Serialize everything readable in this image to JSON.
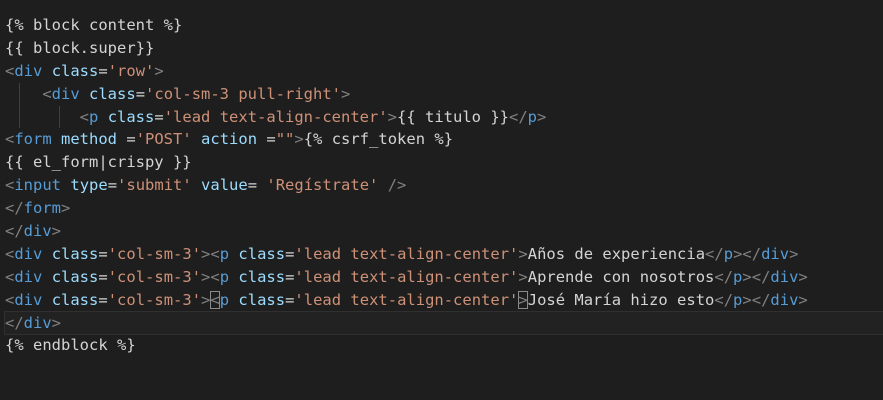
{
  "editor": {
    "current_line": 13,
    "lines": [
      {
        "indent": 0,
        "tokens": [
          {
            "t": "{% block content %}",
            "c": "text"
          }
        ]
      },
      {
        "indent": 0,
        "tokens": [
          {
            "t": "{{ block.super}}",
            "c": "text"
          }
        ]
      },
      {
        "indent": 0,
        "tokens": [
          {
            "t": "<",
            "c": "punct"
          },
          {
            "t": "div",
            "c": "tag"
          },
          {
            "t": " ",
            "c": "text"
          },
          {
            "t": "class",
            "c": "attr"
          },
          {
            "t": "=",
            "c": "text"
          },
          {
            "t": "'row'",
            "c": "str"
          },
          {
            "t": ">",
            "c": "punct"
          }
        ]
      },
      {
        "indent": 1,
        "tokens": [
          {
            "t": "<",
            "c": "punct"
          },
          {
            "t": "div",
            "c": "tag"
          },
          {
            "t": " ",
            "c": "text"
          },
          {
            "t": "class",
            "c": "attr"
          },
          {
            "t": "=",
            "c": "text"
          },
          {
            "t": "'col-sm-3 pull-right'",
            "c": "str"
          },
          {
            "t": ">",
            "c": "punct"
          }
        ]
      },
      {
        "indent": 2,
        "tokens": [
          {
            "t": "<",
            "c": "punct"
          },
          {
            "t": "p",
            "c": "tag"
          },
          {
            "t": " ",
            "c": "text"
          },
          {
            "t": "class",
            "c": "attr"
          },
          {
            "t": "=",
            "c": "text"
          },
          {
            "t": "'lead text-align-center'",
            "c": "str"
          },
          {
            "t": ">",
            "c": "punct"
          },
          {
            "t": "{{ titulo }}",
            "c": "text"
          },
          {
            "t": "</",
            "c": "punct"
          },
          {
            "t": "p",
            "c": "tag"
          },
          {
            "t": ">",
            "c": "punct"
          }
        ]
      },
      {
        "indent": 0,
        "tokens": [
          {
            "t": "<",
            "c": "punct"
          },
          {
            "t": "form",
            "c": "tag"
          },
          {
            "t": " ",
            "c": "text"
          },
          {
            "t": "method",
            "c": "attr"
          },
          {
            "t": " =",
            "c": "text"
          },
          {
            "t": "'POST'",
            "c": "str"
          },
          {
            "t": " ",
            "c": "text"
          },
          {
            "t": "action",
            "c": "attr"
          },
          {
            "t": " =",
            "c": "text"
          },
          {
            "t": "\"\"",
            "c": "str"
          },
          {
            "t": ">",
            "c": "punct"
          },
          {
            "t": "{% csrf_token %}",
            "c": "text"
          }
        ]
      },
      {
        "indent": 0,
        "tokens": [
          {
            "t": "{{ el_form|crispy }}",
            "c": "text"
          }
        ]
      },
      {
        "indent": 0,
        "tokens": [
          {
            "t": "<",
            "c": "punct"
          },
          {
            "t": "input",
            "c": "tag"
          },
          {
            "t": " ",
            "c": "text"
          },
          {
            "t": "type",
            "c": "attr"
          },
          {
            "t": "=",
            "c": "text"
          },
          {
            "t": "'submit'",
            "c": "str"
          },
          {
            "t": " ",
            "c": "text"
          },
          {
            "t": "value",
            "c": "attr"
          },
          {
            "t": "= ",
            "c": "text"
          },
          {
            "t": "'Regístrate'",
            "c": "str"
          },
          {
            "t": " />",
            "c": "punct"
          }
        ]
      },
      {
        "indent": 0,
        "tokens": [
          {
            "t": "</",
            "c": "punct"
          },
          {
            "t": "form",
            "c": "tag"
          },
          {
            "t": ">",
            "c": "punct"
          }
        ]
      },
      {
        "indent": 0,
        "tokens": [
          {
            "t": "</",
            "c": "punct"
          },
          {
            "t": "div",
            "c": "tag"
          },
          {
            "t": ">",
            "c": "punct"
          }
        ]
      },
      {
        "indent": 0,
        "tokens": [
          {
            "t": "<",
            "c": "punct"
          },
          {
            "t": "div",
            "c": "tag"
          },
          {
            "t": " ",
            "c": "text"
          },
          {
            "t": "class",
            "c": "attr"
          },
          {
            "t": "=",
            "c": "text"
          },
          {
            "t": "'col-sm-3'",
            "c": "str"
          },
          {
            "t": ">",
            "c": "punct"
          },
          {
            "t": "<",
            "c": "punct"
          },
          {
            "t": "p",
            "c": "tag"
          },
          {
            "t": " ",
            "c": "text"
          },
          {
            "t": "class",
            "c": "attr"
          },
          {
            "t": "=",
            "c": "text"
          },
          {
            "t": "'lead text-align-center'",
            "c": "str"
          },
          {
            "t": ">",
            "c": "punct"
          },
          {
            "t": "Años de experiencia",
            "c": "text"
          },
          {
            "t": "</",
            "c": "punct"
          },
          {
            "t": "p",
            "c": "tag"
          },
          {
            "t": ">",
            "c": "punct"
          },
          {
            "t": "</",
            "c": "punct"
          },
          {
            "t": "div",
            "c": "tag"
          },
          {
            "t": ">",
            "c": "punct"
          }
        ]
      },
      {
        "indent": 0,
        "tokens": [
          {
            "t": "<",
            "c": "punct"
          },
          {
            "t": "div",
            "c": "tag"
          },
          {
            "t": " ",
            "c": "text"
          },
          {
            "t": "class",
            "c": "attr"
          },
          {
            "t": "=",
            "c": "text"
          },
          {
            "t": "'col-sm-3'",
            "c": "str"
          },
          {
            "t": ">",
            "c": "punct"
          },
          {
            "t": "<",
            "c": "punct"
          },
          {
            "t": "p",
            "c": "tag"
          },
          {
            "t": " ",
            "c": "text"
          },
          {
            "t": "class",
            "c": "attr"
          },
          {
            "t": "=",
            "c": "text"
          },
          {
            "t": "'lead text-align-center'",
            "c": "str"
          },
          {
            "t": ">",
            "c": "punct"
          },
          {
            "t": "Aprende con nosotros",
            "c": "text"
          },
          {
            "t": "</",
            "c": "punct"
          },
          {
            "t": "p",
            "c": "tag"
          },
          {
            "t": ">",
            "c": "punct"
          },
          {
            "t": "</",
            "c": "punct"
          },
          {
            "t": "div",
            "c": "tag"
          },
          {
            "t": ">",
            "c": "punct"
          }
        ]
      },
      {
        "indent": 0,
        "tokens": [
          {
            "t": "<",
            "c": "punct"
          },
          {
            "t": "div",
            "c": "tag"
          },
          {
            "t": " ",
            "c": "text"
          },
          {
            "t": "class",
            "c": "attr"
          },
          {
            "t": "=",
            "c": "text"
          },
          {
            "t": "'col-sm-3'",
            "c": "str"
          },
          {
            "t": ">",
            "c": "punct"
          },
          {
            "t": "<",
            "c": "punct",
            "m": true
          },
          {
            "t": "p",
            "c": "tag"
          },
          {
            "t": " ",
            "c": "text"
          },
          {
            "t": "class",
            "c": "attr"
          },
          {
            "t": "=",
            "c": "text"
          },
          {
            "t": "'lead text-align-center'",
            "c": "str"
          },
          {
            "t": ">",
            "c": "punct",
            "m": true
          },
          {
            "t": "José María hizo esto",
            "c": "text"
          },
          {
            "t": "</",
            "c": "punct"
          },
          {
            "t": "p",
            "c": "tag"
          },
          {
            "t": ">",
            "c": "punct"
          },
          {
            "t": "</",
            "c": "punct"
          },
          {
            "t": "div",
            "c": "tag"
          },
          {
            "t": ">",
            "c": "punct"
          }
        ]
      },
      {
        "indent": 0,
        "tokens": [
          {
            "t": "</",
            "c": "punct"
          },
          {
            "t": "div",
            "c": "tag"
          },
          {
            "t": ">",
            "c": "punct"
          }
        ]
      },
      {
        "indent": 0,
        "tokens": [
          {
            "t": "{% endblock %}",
            "c": "text"
          }
        ]
      }
    ]
  },
  "theme": {
    "background": "#1e1e1e",
    "text": "#d4d4d4",
    "tag": "#569cd6",
    "attribute": "#9cdcfe",
    "string": "#ce9178",
    "punctuation": "#808080"
  }
}
